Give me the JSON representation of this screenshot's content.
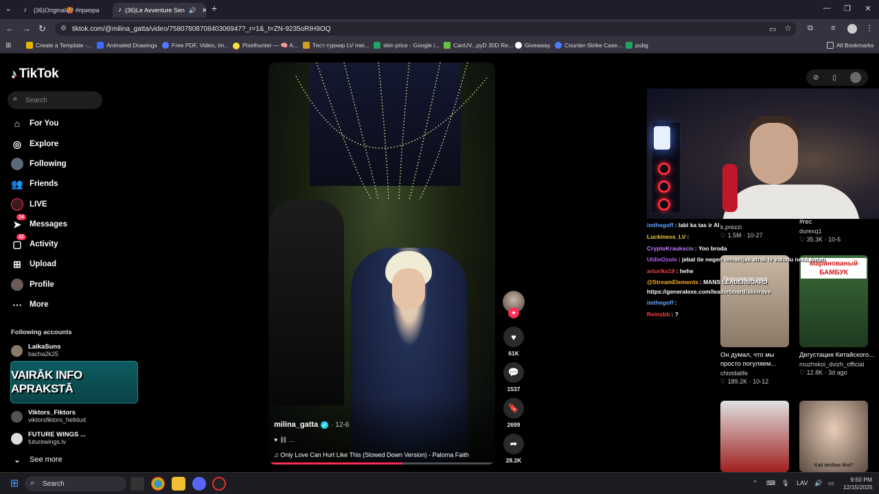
{
  "browser": {
    "tabs": [
      {
        "title": "(36)Original🥵 #приора"
      },
      {
        "title": "(36)Le Avventure Sen"
      }
    ],
    "url": "tiktok.com/@milina_gatta/video/7580780870840306947?_r=1&_t=ZN-9235oRIH9OQ",
    "bookmarks": [
      "Create a Template -...",
      "Animated Drawings",
      "Free PDF, Video, Im...",
      "Pixelhunter — 🧠 A...",
      "Тест-турнир LV mei...",
      "skin price - Google i...",
      "CanUV...pyD 30D Re...",
      "Giveaway",
      "Counter-Strike Case...",
      "pubg"
    ],
    "all_bookmarks": "All Bookmarks"
  },
  "sidebar": {
    "logo": "TikTok",
    "search_placeholder": "Search",
    "items": [
      {
        "label": "For You",
        "icon": "home-icon"
      },
      {
        "label": "Explore",
        "icon": "compass-icon"
      },
      {
        "label": "Following",
        "icon": "following-icon"
      },
      {
        "label": "Friends",
        "icon": "friends-icon"
      },
      {
        "label": "LIVE",
        "icon": "live-icon"
      },
      {
        "label": "Messages",
        "icon": "messages-icon",
        "badge": "14"
      },
      {
        "label": "Activity",
        "icon": "activity-icon",
        "badge": "22"
      },
      {
        "label": "Upload",
        "icon": "upload-icon"
      },
      {
        "label": "Profile",
        "icon": "profile-icon"
      },
      {
        "label": "More",
        "icon": "more-icon"
      }
    ],
    "following_title": "Following accounts",
    "accounts": [
      {
        "name": "LaikaSuns",
        "handle": "bacha2k25"
      },
      {
        "name": "Viktors_Fiktors",
        "handle": "viktorsfiktors_helldud"
      },
      {
        "name": "FUTURE WINGS ...",
        "handle": "futurewings.lv"
      }
    ],
    "promo_text": "VAIRĀK INFO APRAKSTĀ",
    "see_more": "See more"
  },
  "video": {
    "author": "milina_gatta",
    "date": "· 12-6",
    "description": "♥ ⛓ ...",
    "song": "♫  Only Love Can Hurt Like This (Slowed Down Version) - Paloma Faith",
    "progress": 0.59
  },
  "actions": {
    "likes": "61K",
    "comments": "1537",
    "saves": "2699",
    "shares": "28.2K"
  },
  "chat": [
    {
      "user": "imthegoff",
      "msg": ": labi ka tas ir AI",
      "color": "#6aa6ff"
    },
    {
      "user": "Luckiness_LV",
      "msg": ":",
      "color": "#f0d040"
    },
    {
      "user": "CryptoKraukscis",
      "msg": ": Yoo broda",
      "color": "#c080ff"
    },
    {
      "user": "UldisOzols",
      "msg": ": jebal tie negeri iemacijas atrak lv valodu nekā kuteh",
      "color": "#c060ff"
    },
    {
      "user": "arturiks19",
      "msg": ": hehe",
      "color": "#ff4040"
    },
    {
      "user": "@StreamElements",
      "msg": ": MANS LEADERBOARD",
      "color": "#ffb020"
    },
    {
      "user": "",
      "msg": "https://generalexe.com/leaderboard/skinrave",
      "color": "#fff"
    },
    {
      "user": "imthegoff",
      "msg": ":",
      "color": "#6aa6ff"
    },
    {
      "user": "Reinxbb",
      "msg": ": ?",
      "color": "#ff4040"
    }
  ],
  "recommended": [
    {
      "caption": "#rec",
      "user": "durexq1",
      "likes": "35.3K",
      "date": "10-5"
    },
    {
      "caption": "k.prezzi",
      "user": "",
      "likes": "1.5M",
      "date": "10-27"
    },
    {
      "caption": "Он думал, что мы просто погуляем...",
      "user": "chistdalife",
      "likes": "189.2K",
      "date": "10-12",
      "overlay": "Прогулка по лесу"
    },
    {
      "caption": "Дегустация Китайского...",
      "user": "muzhskoi_dvizh_official",
      "likes": "12.8K",
      "date": "3d ago",
      "overlay": "Маринованый БАМБУК"
    },
    {
      "caption": "",
      "user": "",
      "likes": "",
      "date": "",
      "overlay": ""
    },
    {
      "caption": "",
      "user": "",
      "likes": "",
      "date": "",
      "overlay": "Kad tiesības liksi?"
    }
  ],
  "taskbar": {
    "search": "Search",
    "lang": "LAV",
    "time": "9:50 PM",
    "date": "12/15/2025"
  },
  "colors": {
    "accent": "#fe2c55",
    "verified": "#20d5ec"
  }
}
